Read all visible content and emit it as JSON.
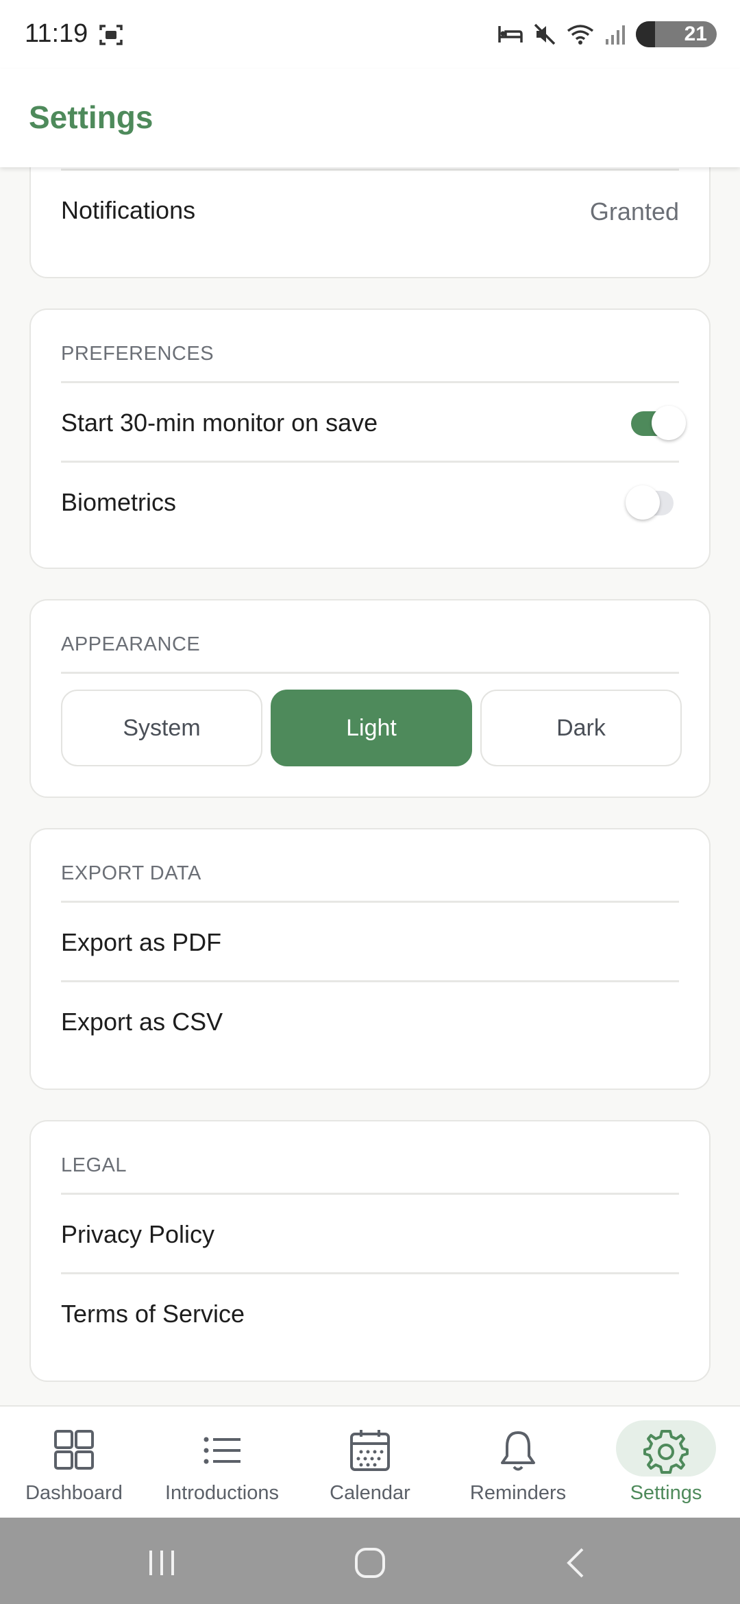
{
  "status_bar": {
    "time": "11:19",
    "battery": "21",
    "icons": [
      "screenshot-icon",
      "bed-icon",
      "mute-icon",
      "wifi-icon",
      "signal-icon",
      "battery-icon"
    ]
  },
  "header": {
    "title": "Settings"
  },
  "permissions": {
    "notifications_label": "Notifications",
    "notifications_value": "Granted"
  },
  "preferences": {
    "title": "PREFERENCES",
    "monitor_label": "Start 30-min monitor on save",
    "monitor_on": true,
    "biometrics_label": "Biometrics",
    "biometrics_on": false
  },
  "appearance": {
    "title": "APPEARANCE",
    "options": [
      "System",
      "Light",
      "Dark"
    ],
    "selected": "Light"
  },
  "export": {
    "title": "EXPORT DATA",
    "pdf": "Export as PDF",
    "csv": "Export as CSV"
  },
  "legal": {
    "title": "LEGAL",
    "privacy": "Privacy Policy",
    "terms": "Terms of Service"
  },
  "bottom_nav": {
    "items": [
      {
        "label": "Dashboard",
        "icon": "dashboard-icon"
      },
      {
        "label": "Introductions",
        "icon": "list-icon"
      },
      {
        "label": "Calendar",
        "icon": "calendar-icon"
      },
      {
        "label": "Reminders",
        "icon": "bell-icon"
      },
      {
        "label": "Settings",
        "icon": "gear-icon"
      }
    ],
    "active": "Settings"
  },
  "colors": {
    "accent": "#4e8a5b",
    "background": "#f8f8f6",
    "card": "#ffffff",
    "muted_text": "#6b6f76"
  }
}
